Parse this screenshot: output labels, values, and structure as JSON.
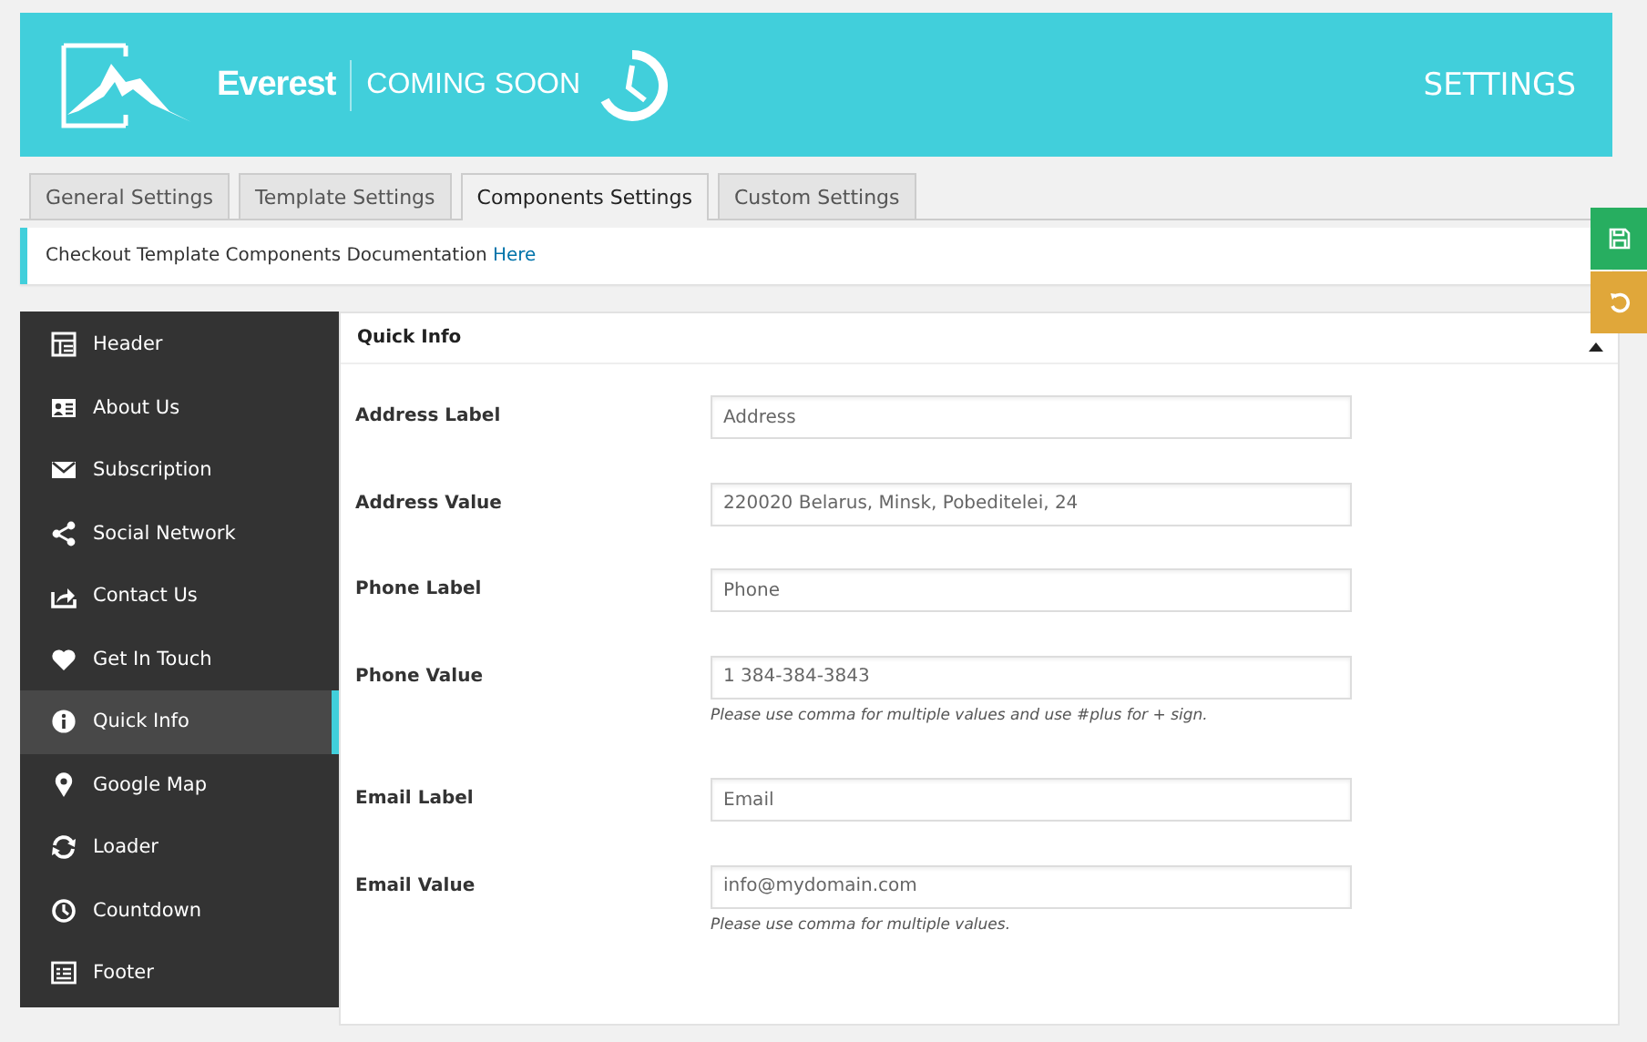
{
  "header": {
    "logo_name": "Everest",
    "logo_tagline": "COMING SOON",
    "title": "SETTINGS"
  },
  "tabs": [
    {
      "label": "General Settings",
      "selected": false
    },
    {
      "label": "Template Settings",
      "selected": false
    },
    {
      "label": "Components Settings",
      "selected": true
    },
    {
      "label": "Custom Settings",
      "selected": false
    }
  ],
  "notice": {
    "text": "Checkout Template Components Documentation",
    "link": "Here"
  },
  "sidebar": {
    "items": [
      {
        "label": "Header",
        "selected": false
      },
      {
        "label": "About Us",
        "selected": false
      },
      {
        "label": "Subscription",
        "selected": false
      },
      {
        "label": "Social Network",
        "selected": false
      },
      {
        "label": "Contact Us",
        "selected": false
      },
      {
        "label": "Get In Touch",
        "selected": false
      },
      {
        "label": "Quick Info",
        "selected": true
      },
      {
        "label": "Google Map",
        "selected": false
      },
      {
        "label": "Loader",
        "selected": false
      },
      {
        "label": "Countdown",
        "selected": false
      },
      {
        "label": "Footer",
        "selected": false
      }
    ]
  },
  "panel": {
    "title": "Quick Info",
    "expanded": true,
    "fields": [
      {
        "label": "Address Label",
        "value": "Address"
      },
      {
        "label": "Address Value",
        "value": "220020 Belarus, Minsk, Pobeditelei, 24"
      },
      {
        "label": "Phone Label",
        "value": "Phone"
      },
      {
        "label": "Phone Value",
        "value": "1 384-384-3843",
        "hint": "Please use comma for multiple values and use #plus for + sign."
      },
      {
        "label": "Email Label",
        "value": "Email"
      },
      {
        "label": "Email Value",
        "value": "info@mydomain.com",
        "hint": "Please use comma for multiple values."
      }
    ]
  }
}
